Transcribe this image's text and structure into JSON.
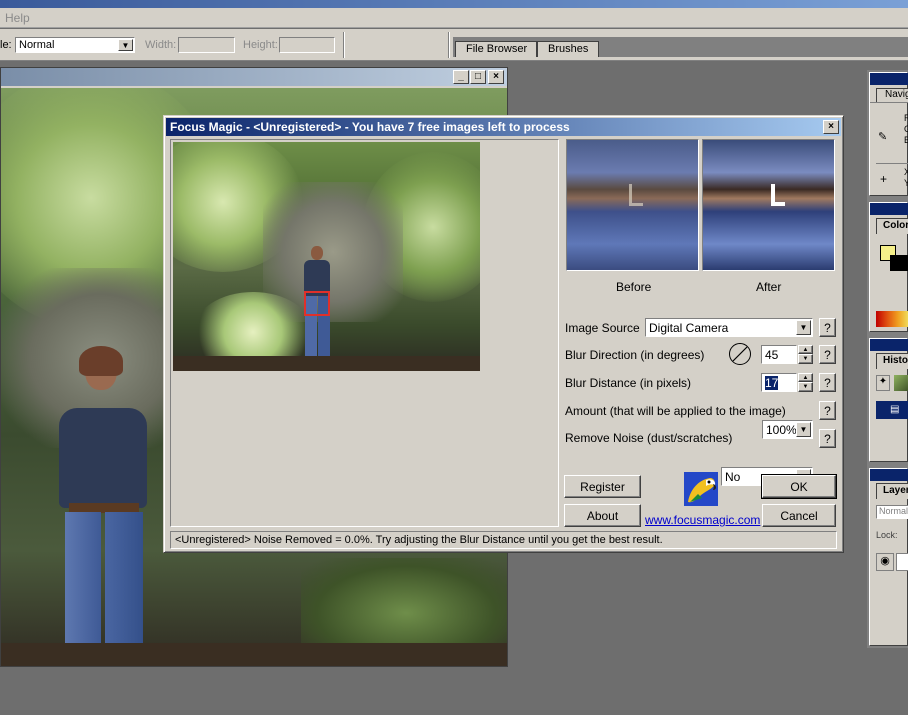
{
  "menubar": {
    "help": "Help"
  },
  "options_bar": {
    "mode_label": "le:",
    "mode_value": "Normal",
    "width_label": "Width:",
    "height_label": "Height:"
  },
  "palette_tabs": [
    "File Browser",
    "Brushes"
  ],
  "right_panels": {
    "navigator_tab": "Navig",
    "color_tab": "Color",
    "history_tab": "Histo",
    "layers_tab": "Layer",
    "layers_mode": "Normal",
    "lock_label": "Lock:",
    "nav_letters": [
      "R",
      "G",
      "B"
    ],
    "nav_letters2": [
      "X",
      "Y"
    ]
  },
  "dialog": {
    "title": "Focus Magic - <Unregistered> - You have 7 free images left to process",
    "before_label": "Before",
    "after_label": "After",
    "image_source_label": "Image Source",
    "image_source_value": "Digital Camera",
    "blur_direction_label": "Blur Direction (in degrees)",
    "blur_direction_value": "45",
    "blur_distance_label": "Blur Distance (in pixels)",
    "blur_distance_value": "17",
    "amount_label": "Amount (that will be applied to the image)",
    "amount_value": "100%",
    "remove_noise_label": "Remove Noise (dust/scratches)",
    "remove_noise_value": "No",
    "help_glyph": "?",
    "register_label": "Register",
    "about_label": "About",
    "ok_label": "OK",
    "cancel_label": "Cancel",
    "website": "www.focusmagic.com",
    "status": "<Unregistered> Noise Removed = 0.0%.  Try adjusting the Blur Distance until you get the best result."
  },
  "colors": {
    "title_start": "#0a246a",
    "title_end": "#a6caf0",
    "dialog_face": "#d4d0c8",
    "workspace": "#6e6e6e",
    "selection_box": "#e0302a",
    "link": "#0000cc",
    "color_swatch": "#f6f08a"
  }
}
